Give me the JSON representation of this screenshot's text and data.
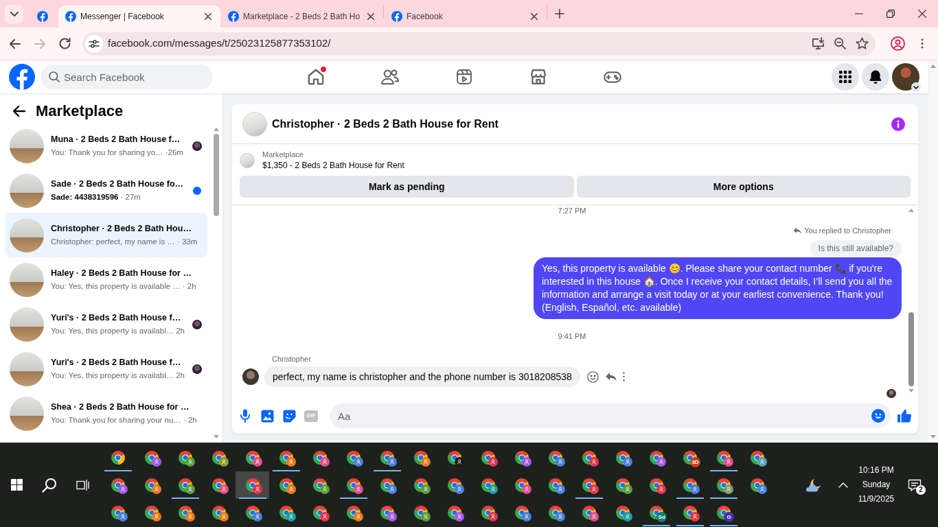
{
  "browser": {
    "tabs": [
      {
        "kind": "pinned",
        "selected": false
      },
      {
        "kind": "page",
        "title": "Messenger | Facebook",
        "selected": true
      },
      {
        "kind": "page",
        "title": "Marketplace - 2 Beds 2 Bath Ho",
        "selected": false
      },
      {
        "kind": "page",
        "title": "Facebook",
        "selected": false
      }
    ],
    "toolbar": [
      {
        "kind": "back",
        "disabled": false
      },
      {
        "kind": "forward",
        "disabled": true
      },
      {
        "kind": "reload",
        "disabled": false
      }
    ],
    "url": "facebook.com/messages/t/25023125877353102/"
  },
  "header": {
    "search": {
      "placeholder": "Search Facebook"
    },
    "nav": [
      {
        "kind": "home",
        "selected": false,
        "notification": true
      },
      {
        "kind": "friends",
        "selected": false,
        "notification": false
      },
      {
        "kind": "video",
        "selected": false,
        "notification": false
      },
      {
        "kind": "marketplace",
        "selected": false,
        "notification": false
      },
      {
        "kind": "gaming",
        "selected": false,
        "notification": false
      }
    ]
  },
  "sidebar": {
    "title": "Marketplace",
    "conversations": [
      {
        "name": "Muna · 2 Beds 2 Bath House f…",
        "preview": "You: Thank you for sharing yo…",
        "time": "·26m",
        "selected": false,
        "unread": false,
        "seen": true
      },
      {
        "name": "Sade · 2 Beds 2 Bath House fo…",
        "preview": "Sade: 4438319596",
        "time": "· 27m",
        "selected": false,
        "unread": true,
        "seen": false
      },
      {
        "name": "Christopher · 2 Beds 2 Bath Hou…",
        "preview": "Christopher: perfect, my name is …",
        "time": "· 33m",
        "selected": true,
        "unread": false,
        "seen": false
      },
      {
        "name": "Haley · 2 Beds 2 Bath House for …",
        "preview": "You: Yes, this property is available …",
        "time": "· 2h",
        "selected": false,
        "unread": false,
        "seen": false
      },
      {
        "name": "Yuri's · 2 Beds 2 Bath House f…",
        "preview": "You: Yes, this property is availabl…",
        "time": "2h",
        "selected": false,
        "unread": false,
        "seen": true
      },
      {
        "name": "Yuri's · 2 Beds 2 Bath House f…",
        "preview": "You: Yes, this property is availabl…",
        "time": "2h",
        "selected": false,
        "unread": false,
        "seen": true
      },
      {
        "name": "Shea · 2 Beds 2 Bath House for …",
        "preview": "You: Thank you for sharing your nu…",
        "time": "· 2h",
        "selected": false,
        "unread": false,
        "seen": false
      }
    ]
  },
  "chat": {
    "title": "Christopher · 2 Beds 2 Bath House for Rent",
    "listing": {
      "label": "Marketplace",
      "title": "$1,350 - 2 Beds 2 Bath House for Rent"
    },
    "actions": [
      "Mark as pending",
      "More options"
    ],
    "messages": [
      {
        "kind": "timestamp",
        "text": "7:27 PM"
      },
      {
        "kind": "reply_note",
        "text": "You replied to Christopher"
      },
      {
        "kind": "quote",
        "text": "Is this still available?"
      },
      {
        "kind": "outgoing",
        "text": "Yes, this property is available 😊. Please share your contact number 📞 if you're interested in this house 🏠. Once I receive your contact details, I’ll send you all the information and arrange a visit today or at your earliest convenience. Thank you! (English, Español, etc. available)"
      },
      {
        "kind": "timestamp",
        "text": "9:41 PM"
      },
      {
        "kind": "sender",
        "text": "Christopher"
      },
      {
        "kind": "incoming",
        "text": "perfect, my name is christopher and the phone number is 3018208538",
        "hovered": true
      },
      {
        "kind": "seen_receipt"
      }
    ],
    "composer": {
      "tools": [
        {
          "kind": "mic"
        },
        {
          "kind": "photo"
        },
        {
          "kind": "sticker"
        },
        {
          "kind": "gif",
          "label": "GIF"
        }
      ],
      "placeholder": "Aa"
    }
  },
  "taskbar": {
    "apps": [
      {
        "open": true,
        "selected": false
      },
      {
        "color": "#a259e6",
        "open": false,
        "selected": false
      },
      {
        "color": "#5a9e3a",
        "open": false,
        "selected": false
      },
      {
        "color": "#8d9b2f",
        "open": false,
        "selected": false
      },
      {
        "color": "#e04e8c",
        "open": false,
        "selected": false
      },
      {
        "color": "#e67a1e",
        "open": true,
        "selected": false
      },
      {
        "color": "#e04e8c",
        "open": false,
        "selected": false
      },
      {
        "color": "#4a7fd8",
        "open": false,
        "selected": false
      },
      {
        "color": "#4a7fd8",
        "open": true,
        "selected": false
      },
      {
        "color": "#e67a1e",
        "open": false,
        "selected": false
      },
      {
        "color": "#1b1b1b",
        "open": false,
        "selected": false
      },
      {
        "color": "#e0344d",
        "open": false,
        "selected": false
      },
      {
        "color": "#a259e6",
        "open": false,
        "selected": false
      },
      {
        "color": "#4a7fd8",
        "open": false,
        "selected": false
      },
      {
        "color": "#e0344d",
        "open": false,
        "selected": false
      },
      {
        "color": "#4a7fd8",
        "open": false,
        "selected": false
      },
      {
        "color": "#a259e6",
        "open": false,
        "selected": false
      },
      {
        "color": "#c9401f",
        "badge": "3D",
        "open": false,
        "selected": false
      },
      {
        "color": "#e04e8c",
        "open": true,
        "selected": false
      },
      {
        "color": "#5e9fb0",
        "open": false,
        "selected": false
      },
      {
        "color": "#a259e6",
        "open": false,
        "selected": false
      },
      {
        "color": "#e67a1e",
        "open": false,
        "selected": false
      },
      {
        "color": "#5a9e3a",
        "open": true,
        "selected": false
      },
      {
        "color": "#e04e8c",
        "open": false,
        "selected": false
      },
      {
        "color": "#e0344d",
        "open": true,
        "selected": true
      },
      {
        "color": "#e67a1e",
        "open": false,
        "selected": false
      },
      {
        "color": "#5a9e3a",
        "open": false,
        "selected": false
      },
      {
        "color": "#e04e8c",
        "open": true,
        "selected": false
      },
      {
        "color": "#4a7fd8",
        "open": false,
        "selected": false
      },
      {
        "color": "#5a9e3a",
        "open": false,
        "selected": false
      },
      {
        "color": "#4a7fd8",
        "open": false,
        "selected": false
      },
      {
        "color": "#1f9ea0",
        "open": false,
        "selected": false
      },
      {
        "color": "#e04e8c",
        "open": false,
        "selected": false
      },
      {
        "color": "#4a7fd8",
        "open": false,
        "selected": false
      },
      {
        "color": "#e0344d",
        "open": true,
        "selected": false
      },
      {
        "color": "#5a9e3a",
        "open": false,
        "selected": false
      },
      {
        "color": "#e0344d",
        "open": false,
        "selected": false
      },
      {
        "color": "#4a7fd8",
        "open": true,
        "selected": false
      },
      {
        "color": "#7fa06a",
        "open": true,
        "selected": false
      },
      {
        "color": "#4a7fd8",
        "open": false,
        "selected": false
      },
      {
        "color": "#4a7fd8",
        "open": false,
        "selected": false
      },
      {
        "color": "#e67a1e",
        "open": false,
        "selected": false
      },
      {
        "color": "#e67a1e",
        "open": false,
        "selected": false
      },
      {
        "color": "#e67a1e",
        "open": false,
        "selected": false
      },
      {
        "color": "#4a7fd8",
        "open": false,
        "selected": false
      },
      {
        "color": "#1f9ea0",
        "open": false,
        "selected": false
      },
      {
        "color": "#e0344d",
        "open": false,
        "selected": false
      },
      {
        "color": "#e67a1e",
        "open": false,
        "selected": false
      },
      {
        "color": "#a259e6",
        "open": false,
        "selected": false
      },
      {
        "color": "#5a9e3a",
        "open": false,
        "selected": false
      },
      {
        "color": "#a259e6",
        "open": false,
        "selected": false
      },
      {
        "color": "#e0344d",
        "open": false,
        "selected": false
      },
      {
        "color": "#4a7fd8",
        "open": false,
        "selected": false
      },
      {
        "color": "#4a7fd8",
        "open": false,
        "selected": false
      },
      {
        "color": "#e04e8c",
        "open": false,
        "selected": false
      },
      {
        "color": "#1f9ea0",
        "open": false,
        "selected": false
      },
      {
        "color": "#0f7b6f",
        "badge": "Sd",
        "open": true,
        "selected": false
      },
      {
        "color": "#e0344d",
        "open": true,
        "selected": false
      },
      {
        "color": "#4a2fa6",
        "badge": "G",
        "open": true,
        "selected": false
      }
    ],
    "clock": {
      "time": "10:16 PM",
      "day": "Sunday",
      "date": "11/9/2025"
    },
    "notifications": "2"
  }
}
